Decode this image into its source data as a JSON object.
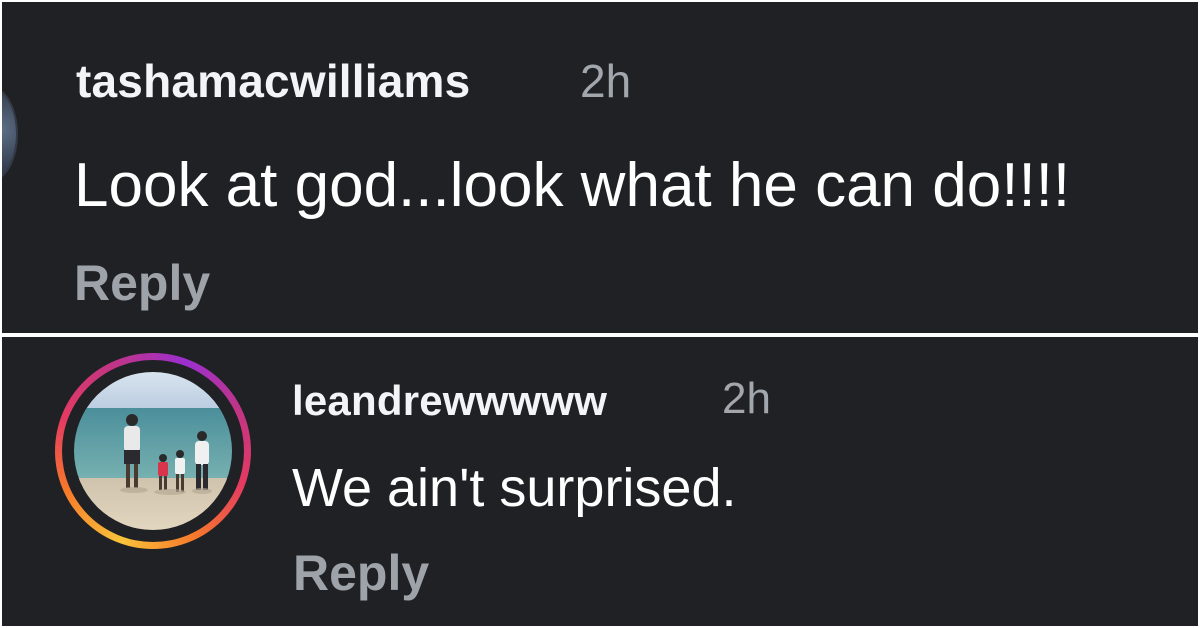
{
  "comments": [
    {
      "username": "tashamacwilliams",
      "time": "2h",
      "text": "Look at god...look what he can do!!!!",
      "reply_label": "Reply"
    },
    {
      "username": "leandrewwwww",
      "time": "2h",
      "text": "We ain't surprised.",
      "reply_label": "Reply"
    }
  ],
  "colors": {
    "background": "#202124",
    "username": "#f3f4f6",
    "timestamp": "#a2a6ad",
    "reply": "#9ea2a9"
  }
}
